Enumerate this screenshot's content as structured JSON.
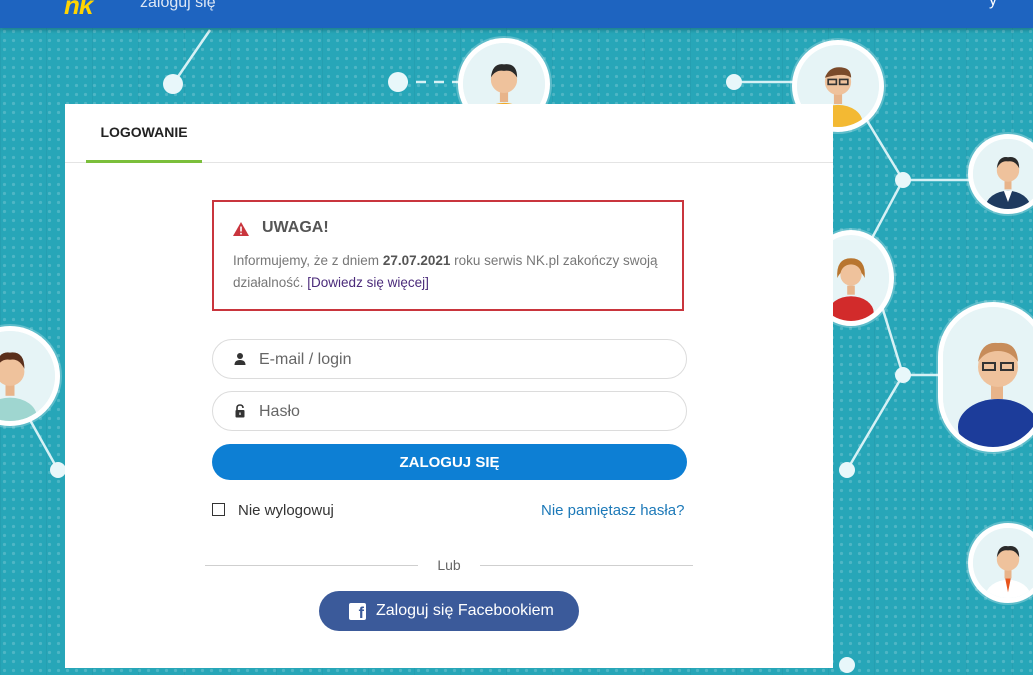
{
  "topbar": {
    "logo": "nk",
    "title": "zaloguj się",
    "right": "y"
  },
  "tabs": [
    {
      "label": "LOGOWANIE",
      "active": true
    }
  ],
  "alert": {
    "title": "UWAGA!",
    "text_before": "Informujemy, że z dniem ",
    "date": "27.07.2021",
    "text_after": " roku serwis NK.pl zakończy swoją działalność. ",
    "link": "[Dowiedz się więcej]"
  },
  "form": {
    "email_placeholder": "E-mail / login",
    "password_placeholder": "Hasło",
    "login_button": "ZALOGUJ SIĘ",
    "remember_label": "Nie wylogowuj",
    "forgot_link": "Nie pamiętasz hasła?",
    "or_text": "Lub",
    "facebook_button": "Zaloguj się Facebookiem"
  },
  "icons": {
    "alert": "warning-triangle-icon",
    "email": "user-icon",
    "password": "lock-icon",
    "facebook": "facebook-icon"
  },
  "colors": {
    "header": "#1e64c0",
    "background": "#27a6b8",
    "tab_underline": "#7bbf3b",
    "alert_border": "#c9353d",
    "primary_button": "#0d7fd4",
    "facebook_button": "#3b5a9a",
    "link": "#1c79b8"
  }
}
